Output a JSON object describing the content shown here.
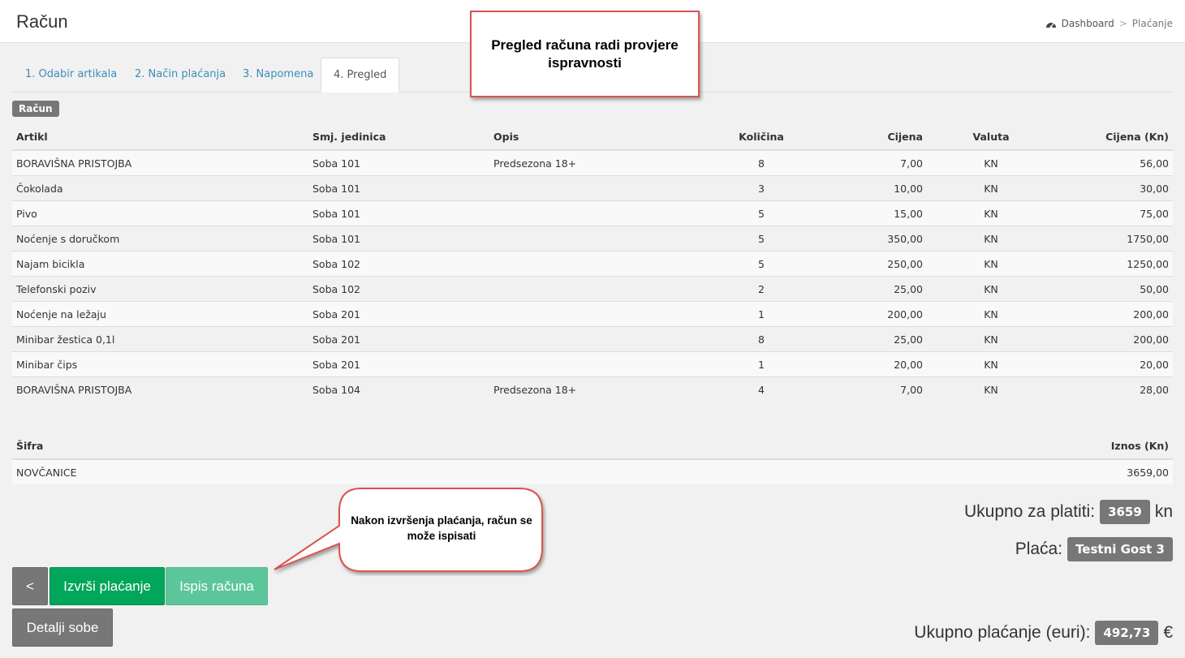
{
  "header": {
    "title": "Račun",
    "breadcrumb": {
      "home": "Dashboard",
      "separator": ">",
      "current": "Plaćanje"
    }
  },
  "tabs": [
    {
      "label": "1. Odabir artikala",
      "active": false
    },
    {
      "label": "2. Način plaćanja",
      "active": false
    },
    {
      "label": "3. Napomena",
      "active": false
    },
    {
      "label": "4. Pregled",
      "active": true
    }
  ],
  "invoice_label": "Račun",
  "items_table": {
    "headers": [
      "Artikl",
      "Smj. jedinica",
      "Opis",
      "Količina",
      "Cijena",
      "Valuta",
      "Cijena (Kn)"
    ],
    "rows": [
      [
        "BORAVIŠNA PRISTOJBA",
        "Soba 101",
        "Predsezona 18+",
        "8",
        "7,00",
        "KN",
        "56,00"
      ],
      [
        "Čokolada",
        "Soba 101",
        "",
        "3",
        "10,00",
        "KN",
        "30,00"
      ],
      [
        "Pivo",
        "Soba 101",
        "",
        "5",
        "15,00",
        "KN",
        "75,00"
      ],
      [
        "Noćenje s doručkom",
        "Soba 101",
        "",
        "5",
        "350,00",
        "KN",
        "1750,00"
      ],
      [
        "Najam bicikla",
        "Soba 102",
        "",
        "5",
        "250,00",
        "KN",
        "1250,00"
      ],
      [
        "Telefonski poziv",
        "Soba 102",
        "",
        "2",
        "25,00",
        "KN",
        "50,00"
      ],
      [
        "Noćenje na ležaju",
        "Soba 201",
        "",
        "1",
        "200,00",
        "KN",
        "200,00"
      ],
      [
        "Minibar žestica 0,1l",
        "Soba 201",
        "",
        "8",
        "25,00",
        "KN",
        "200,00"
      ],
      [
        "Minibar čips",
        "Soba 201",
        "",
        "1",
        "20,00",
        "KN",
        "20,00"
      ],
      [
        "BORAVIŠNA PRISTOJBA",
        "Soba 104",
        "Predsezona 18+",
        "4",
        "7,00",
        "KN",
        "28,00"
      ]
    ]
  },
  "payment_table": {
    "headers": [
      "Šifra",
      "Iznos (Kn)"
    ],
    "rows": [
      [
        "NOVČANICE",
        "3659,00"
      ]
    ]
  },
  "totals": {
    "to_pay_label": "Ukupno za platiti:",
    "to_pay_value": "3659",
    "to_pay_unit": "kn",
    "payer_label": "Plaća:",
    "payer_value": "Testni Gost 3",
    "total_eur_label": "Ukupno plaćanje (euri):",
    "total_eur_value": "492,73",
    "total_eur_unit": "€"
  },
  "buttons": {
    "back": "<",
    "execute": "Izvrši plaćanje",
    "print": "Ispis računa",
    "room_details": "Detalji sobe"
  },
  "annotations": {
    "top_callout": "Pregled računa radi provjere ispravnosti",
    "bubble_callout": "Nakon izvršenja plaćanja, račun se može ispisati"
  },
  "colors": {
    "success": "#00a65a",
    "success_light": "#5cc69a",
    "gray": "#777777",
    "link": "#3c8dbc",
    "callout_border": "#d9534f"
  }
}
